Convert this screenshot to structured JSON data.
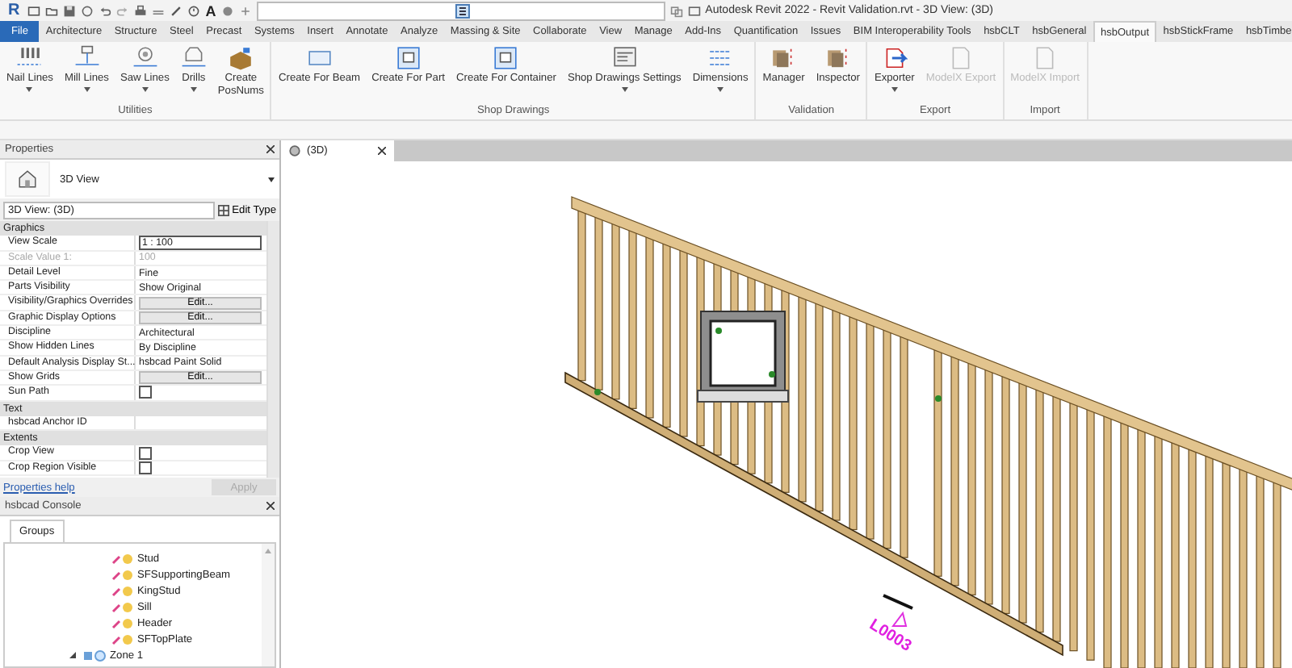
{
  "title_bar": {
    "logo": "R",
    "text_tool": "A",
    "title": "Autodesk Revit 2022 - Revit Validation.rvt - 3D View: (3D)"
  },
  "ribbon_tabs": [
    {
      "label": "File",
      "kind": "file",
      "selected": false
    },
    {
      "label": "Architecture",
      "kind": "tab",
      "selected": false
    },
    {
      "label": "Structure",
      "kind": "tab",
      "selected": false
    },
    {
      "label": "Steel",
      "kind": "tab",
      "selected": false
    },
    {
      "label": "Precast",
      "kind": "tab",
      "selected": false
    },
    {
      "label": "Systems",
      "kind": "tab",
      "selected": false
    },
    {
      "label": "Insert",
      "kind": "tab",
      "selected": false
    },
    {
      "label": "Annotate",
      "kind": "tab",
      "selected": false
    },
    {
      "label": "Analyze",
      "kind": "tab",
      "selected": false
    },
    {
      "label": "Massing & Site",
      "kind": "tab",
      "selected": false
    },
    {
      "label": "Collaborate",
      "kind": "tab",
      "selected": false
    },
    {
      "label": "View",
      "kind": "tab",
      "selected": false
    },
    {
      "label": "Manage",
      "kind": "tab",
      "selected": false
    },
    {
      "label": "Add-Ins",
      "kind": "tab",
      "selected": false
    },
    {
      "label": "Quantification",
      "kind": "tab",
      "selected": false
    },
    {
      "label": "Issues",
      "kind": "tab",
      "selected": false
    },
    {
      "label": "BIM Interoperability Tools",
      "kind": "tab",
      "selected": false
    },
    {
      "label": "hsbCLT",
      "kind": "tab",
      "selected": false
    },
    {
      "label": "hsbGeneral",
      "kind": "tab",
      "selected": false
    },
    {
      "label": "hsbOutput",
      "kind": "tab",
      "selected": true
    },
    {
      "label": "hsbStickFrame",
      "kind": "tab",
      "selected": false
    },
    {
      "label": "hsbTimbe",
      "kind": "tab",
      "selected": false
    }
  ],
  "ribbon_panels": [
    {
      "label": "Utilities",
      "buttons": [
        {
          "label": "Nail Lines",
          "dropdown": true,
          "disabled": false
        },
        {
          "label": "Mill Lines",
          "dropdown": true,
          "disabled": false
        },
        {
          "label": "Saw Lines",
          "dropdown": true,
          "disabled": false
        },
        {
          "label": "Drills",
          "dropdown": true,
          "disabled": false
        },
        {
          "label": "Create\nPosNums",
          "dropdown": false,
          "disabled": false
        }
      ]
    },
    {
      "label": "Shop Drawings",
      "buttons": [
        {
          "label": "Create For Beam",
          "dropdown": false,
          "disabled": false
        },
        {
          "label": "Create For Part",
          "dropdown": false,
          "disabled": false
        },
        {
          "label": "Create For Container",
          "dropdown": false,
          "disabled": false
        },
        {
          "label": "Shop Drawings Settings",
          "dropdown": true,
          "disabled": false
        },
        {
          "label": "Dimensions",
          "dropdown": true,
          "disabled": false
        }
      ]
    },
    {
      "label": "Validation",
      "buttons": [
        {
          "label": "Manager",
          "dropdown": false,
          "disabled": false
        },
        {
          "label": "Inspector",
          "dropdown": false,
          "disabled": false
        }
      ]
    },
    {
      "label": "Export",
      "buttons": [
        {
          "label": "Exporter",
          "dropdown": true,
          "disabled": false
        },
        {
          "label": "ModelX Export",
          "dropdown": false,
          "disabled": true
        }
      ]
    },
    {
      "label": "Import",
      "buttons": [
        {
          "label": "ModelX Import",
          "dropdown": false,
          "disabled": true
        }
      ]
    }
  ],
  "properties": {
    "title": "Properties",
    "type_name": "3D View",
    "selector": "3D View: (3D)",
    "edit_type": "Edit Type",
    "sections": [
      {
        "title": "Graphics",
        "rows": [
          {
            "label": "View Scale",
            "value": "1 : 100",
            "kind": "input"
          },
          {
            "label": "Scale Value    1:",
            "value": "100",
            "kind": "disabled"
          },
          {
            "label": "Detail Level",
            "value": "Fine",
            "kind": "text"
          },
          {
            "label": "Parts Visibility",
            "value": "Show Original",
            "kind": "text"
          },
          {
            "label": "Visibility/Graphics Overrides",
            "value": "Edit...",
            "kind": "button"
          },
          {
            "label": "Graphic Display Options",
            "value": "Edit...",
            "kind": "button"
          },
          {
            "label": "Discipline",
            "value": "Architectural",
            "kind": "text"
          },
          {
            "label": "Show Hidden Lines",
            "value": "By Discipline",
            "kind": "text"
          },
          {
            "label": "Default Analysis Display St...",
            "value": "hsbcad Paint Solid",
            "kind": "text"
          },
          {
            "label": "Show Grids",
            "value": "Edit...",
            "kind": "button"
          },
          {
            "label": "Sun Path",
            "checked": false,
            "kind": "checkbox"
          }
        ]
      },
      {
        "title": "Text",
        "rows": [
          {
            "label": "hsbcad Anchor ID",
            "kind": "empty"
          }
        ]
      },
      {
        "title": "Extents",
        "rows": [
          {
            "label": "Crop View",
            "checked": false,
            "kind": "checkbox"
          },
          {
            "label": "Crop Region Visible",
            "checked": false,
            "kind": "checkbox"
          }
        ]
      }
    ],
    "help_link": "Properties help",
    "apply": "Apply",
    "apply_disabled": true
  },
  "console": {
    "title": "hsbcad Console",
    "tabs": [
      {
        "label": "Groups",
        "selected": true
      }
    ],
    "group_items": [
      {
        "label": "Stud"
      },
      {
        "label": "SFSupportingBeam"
      },
      {
        "label": "KingStud"
      },
      {
        "label": "Sill"
      },
      {
        "label": "Header"
      },
      {
        "label": "SFTopPlate"
      }
    ],
    "zones": [
      {
        "label": "Zone 1",
        "expanded": true
      }
    ]
  },
  "view_tabs": [
    {
      "label": "(3D)",
      "selected": true
    }
  ],
  "canvas": {
    "level_tag": "L0003"
  }
}
